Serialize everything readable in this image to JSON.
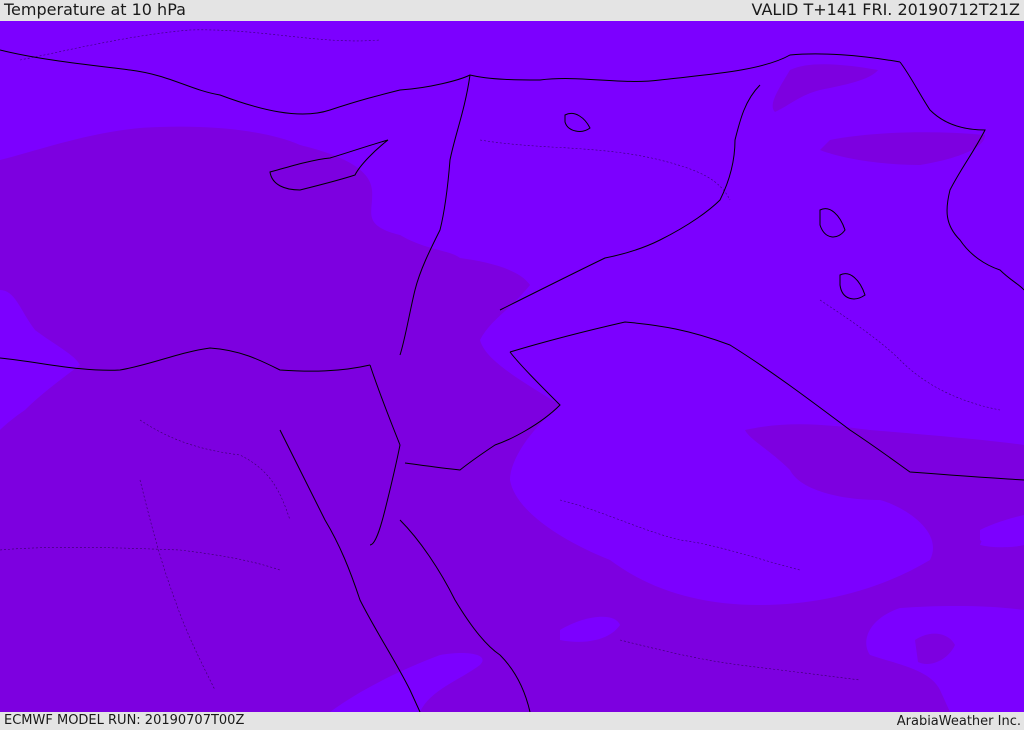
{
  "header": {
    "title": "Temperature at 10 hPa",
    "valid": "VALID T+141 FRI. 20190712T21Z"
  },
  "footer": {
    "model_run": "ECMWF MODEL RUN: 20190707T00Z",
    "credit": "ArabiaWeather Inc."
  },
  "colors": {
    "background_field": "#7c00ff",
    "warmer_field": "#7d00e0",
    "border_line": "#000000",
    "bar_background": "#e4e4e4"
  }
}
